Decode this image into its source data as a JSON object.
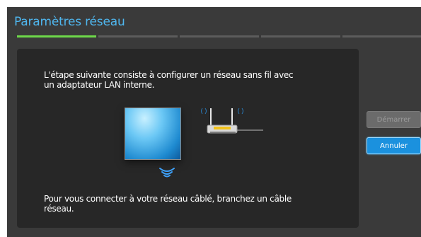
{
  "window": {
    "title": "Paramètres réseau",
    "steps_total": 5,
    "steps_done": 1,
    "accent_color": "#4fb6ee",
    "progress_color": "#6ed84a"
  },
  "content": {
    "intro_text": "L'étape suivante consiste à configurer un réseau sans fil avec un adaptateur LAN interne.",
    "wired_hint": "Pour vous connecter à votre réseau câblé, branchez un câble réseau."
  },
  "buttons": {
    "start_label": "Démarrer",
    "start_enabled": false,
    "cancel_label": "Annuler"
  },
  "icons": {
    "tv": "tv-icon",
    "router": "router-icon",
    "wifi_signal": "wifi-signal-icon"
  }
}
